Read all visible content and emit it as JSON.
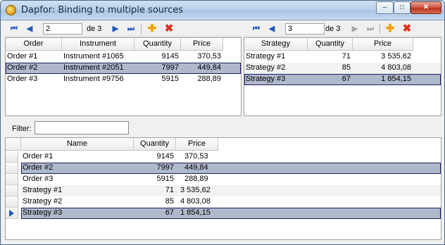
{
  "window": {
    "title": "Dapfor: Binding to multiple sources",
    "min_glyph": "–",
    "max_glyph": "□",
    "close_glyph": "✕"
  },
  "orders_nav": {
    "position": "2",
    "of_label": "de 3"
  },
  "strategies_nav": {
    "position": "3",
    "of_label": "de 3"
  },
  "orders_grid": {
    "columns": [
      "Order",
      "Instrument",
      "Quantity",
      "Price"
    ],
    "rows": [
      {
        "order": "Order #1",
        "instrument": "Instrument #1065",
        "quantity": "9145",
        "price": "370,53"
      },
      {
        "order": "Order #2",
        "instrument": "Instrument #2051",
        "quantity": "7997",
        "price": "449,84"
      },
      {
        "order": "Order #3",
        "instrument": "Instrument #9756",
        "quantity": "5915",
        "price": "288,89"
      }
    ]
  },
  "strategies_grid": {
    "columns": [
      "Strategy",
      "Quantity",
      "Price"
    ],
    "rows": [
      {
        "strategy": "Strategy #1",
        "quantity": "71",
        "price": "3 535,62"
      },
      {
        "strategy": "Strategy #2",
        "quantity": "85",
        "price": "4 803,08"
      },
      {
        "strategy": "Strategy #3",
        "quantity": "67",
        "price": "1 854,15"
      }
    ]
  },
  "filter": {
    "label": "Filter:",
    "value": ""
  },
  "combined_grid": {
    "columns": [
      "Name",
      "Quantity",
      "Price"
    ],
    "rows": [
      {
        "name": "Order #1",
        "quantity": "9145",
        "price": "370,53"
      },
      {
        "name": "Order #2",
        "quantity": "7997",
        "price": "449,84"
      },
      {
        "name": "Order #3",
        "quantity": "5915",
        "price": "288,89"
      },
      {
        "name": "Strategy #1",
        "quantity": "71",
        "price": "3 535,62"
      },
      {
        "name": "Strategy #2",
        "quantity": "85",
        "price": "4 803,08"
      },
      {
        "name": "Strategy #3",
        "quantity": "67",
        "price": "1 854,15"
      }
    ]
  },
  "icons": {
    "first": "⏮",
    "prev": "◀",
    "next": "▶",
    "last": "⏭",
    "add": "✚",
    "delete": "✖"
  },
  "colors": {
    "selection": "#b0b8cc",
    "nav_accent": "#2458b8",
    "add": "#f0a000",
    "delete": "#d83020"
  }
}
